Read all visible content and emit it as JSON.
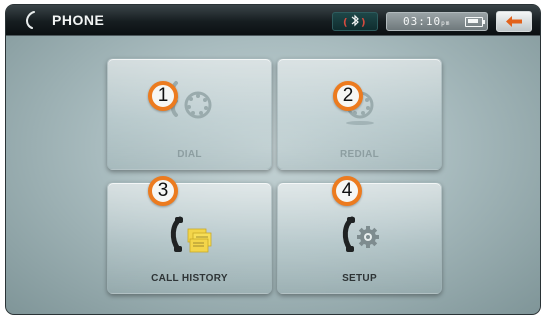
{
  "header": {
    "title": "PHONE",
    "bluetooth_icon": "bluetooth-icon",
    "clock": "03:10",
    "clock_suffix": "pm",
    "battery_icon": "battery-icon",
    "back_icon": "back-arrow-icon"
  },
  "tiles": [
    {
      "label": "DIAL",
      "icon": "dial-keypad-icon",
      "callout": "1",
      "state": "dimmed"
    },
    {
      "label": "REDIAL",
      "icon": "redial-icon",
      "callout": "2",
      "state": "dimmed"
    },
    {
      "label": "CALL HISTORY",
      "icon": "call-history-icon",
      "callout": "3",
      "state": "active"
    },
    {
      "label": "SETUP",
      "icon": "setup-gear-icon",
      "callout": "4",
      "state": "active"
    }
  ],
  "colors": {
    "callout_border": "#ec7b1f",
    "back_arrow": "#e2621b",
    "background": "#a9bcbf"
  }
}
